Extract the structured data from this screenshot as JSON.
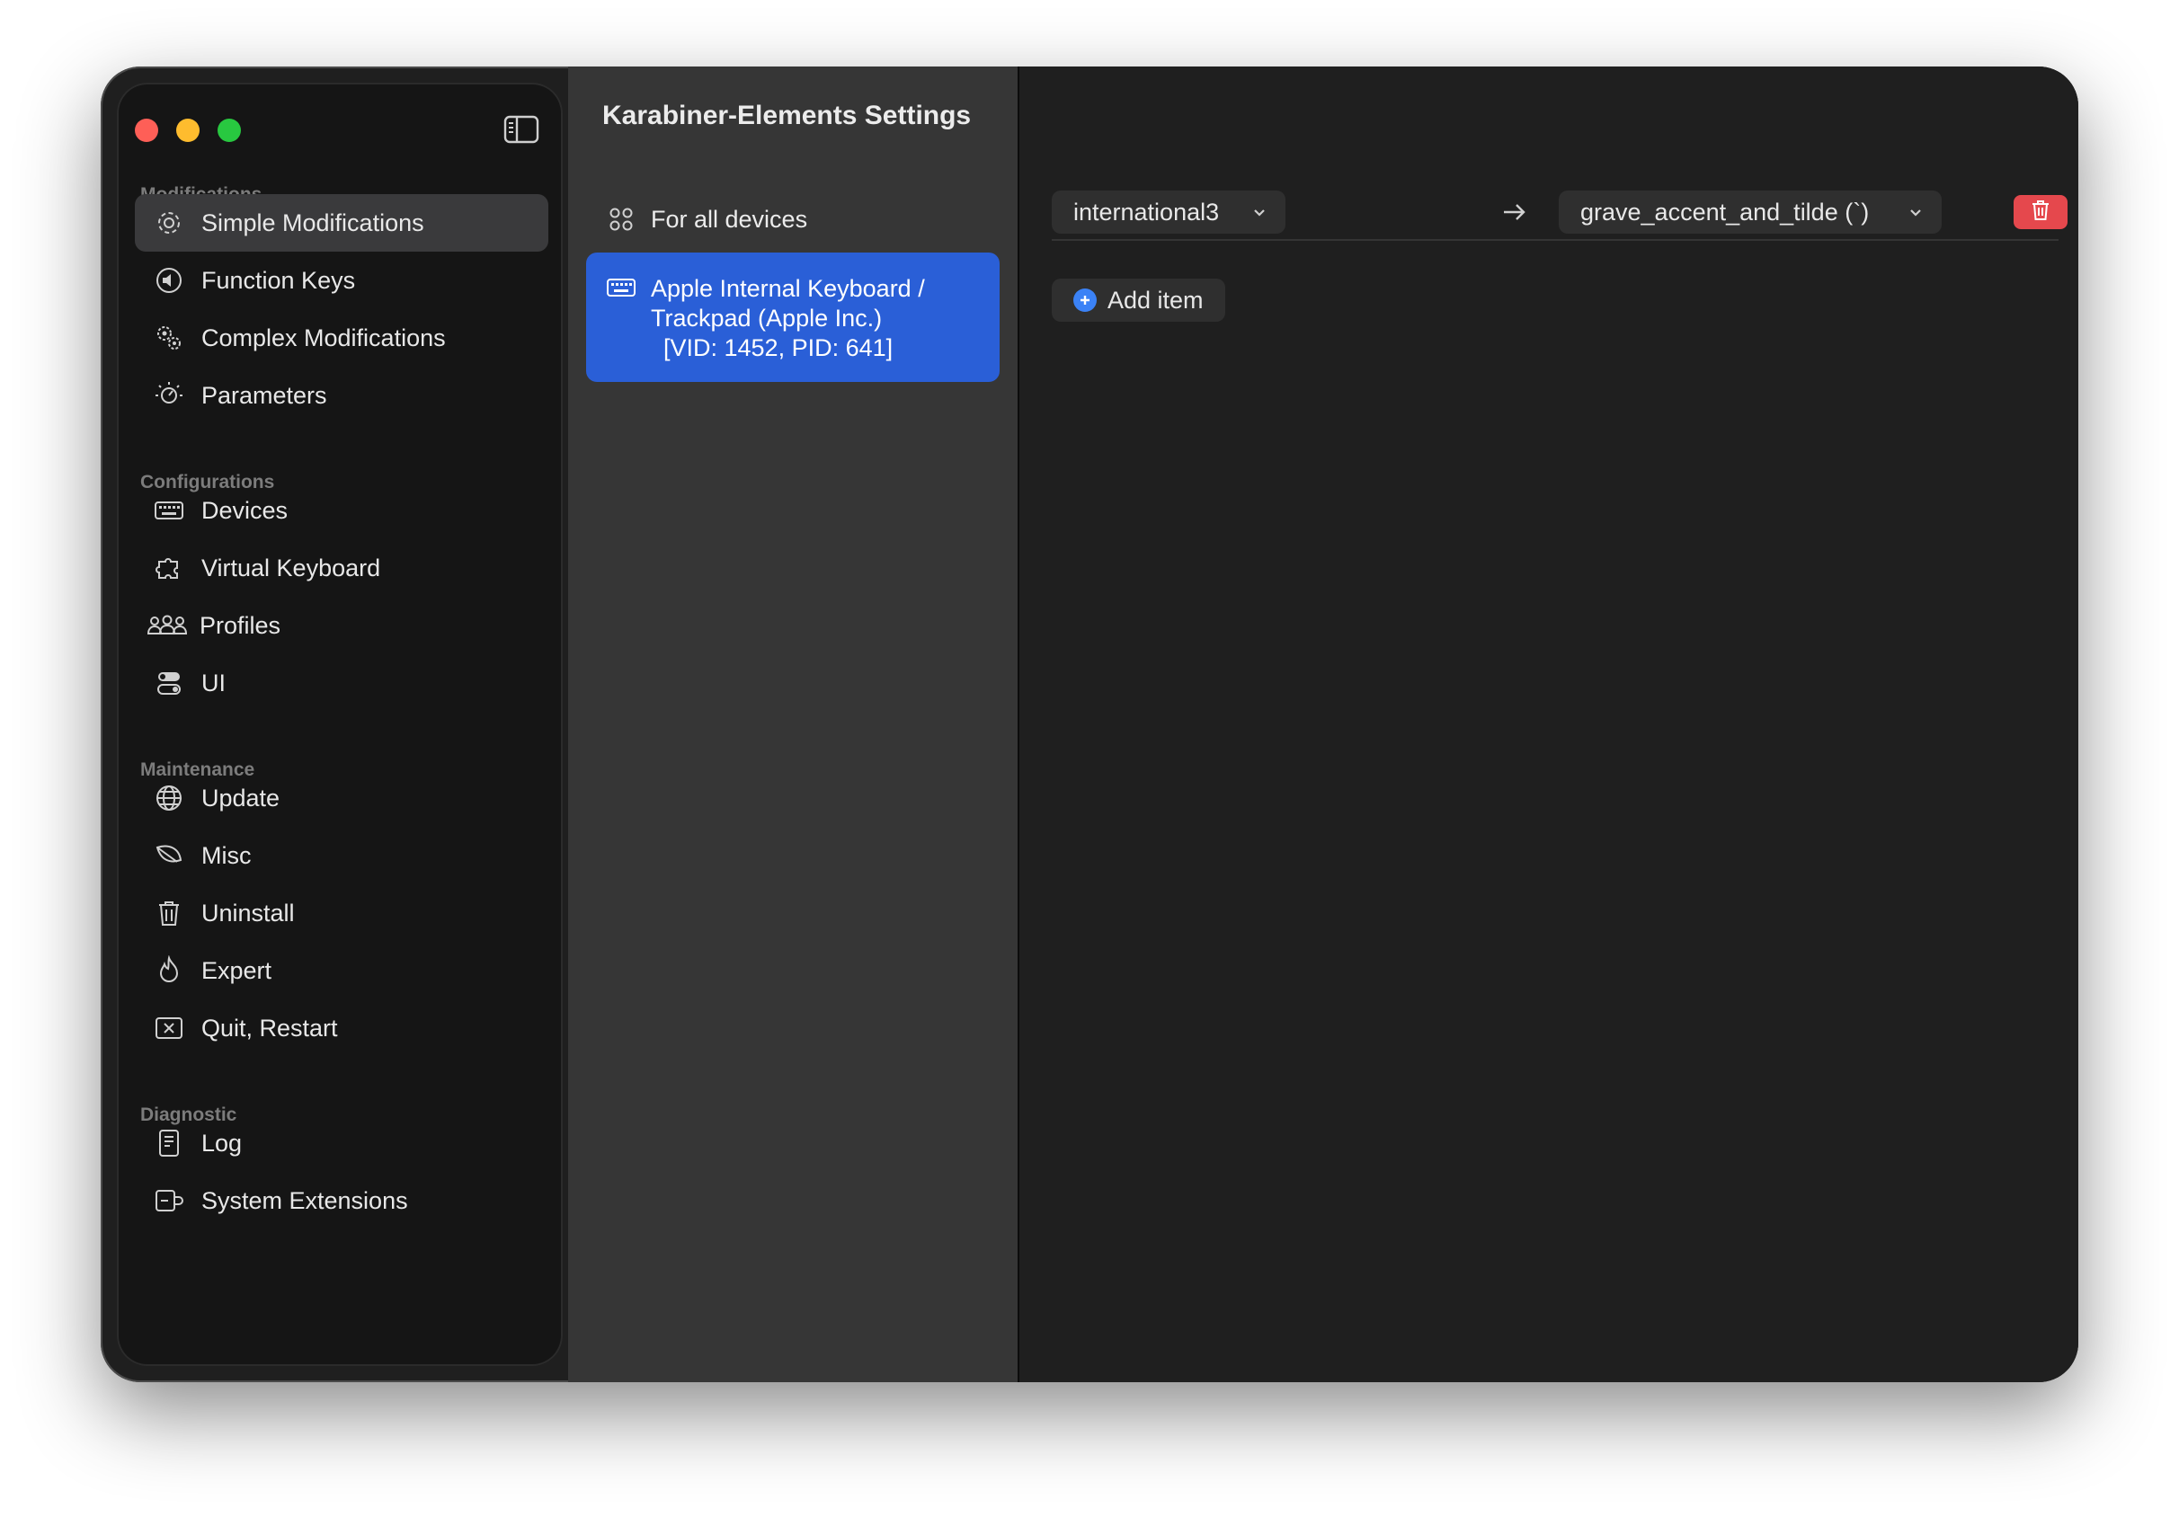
{
  "window": {
    "title": "Karabiner-Elements Settings"
  },
  "sidebar": {
    "sections": [
      {
        "heading": "Modifications",
        "items": [
          {
            "label": "Simple Modifications",
            "icon": "gear-icon",
            "selected": true
          },
          {
            "label": "Function Keys",
            "icon": "speaker-icon"
          },
          {
            "label": "Complex Modifications",
            "icon": "gears-icon"
          },
          {
            "label": "Parameters",
            "icon": "dial-icon"
          }
        ]
      },
      {
        "heading": "Configurations",
        "items": [
          {
            "label": "Devices",
            "icon": "keyboard-icon"
          },
          {
            "label": "Virtual Keyboard",
            "icon": "puzzle-icon"
          },
          {
            "label": "Profiles",
            "icon": "people-icon"
          },
          {
            "label": "UI",
            "icon": "switches-icon"
          }
        ]
      },
      {
        "heading": "Maintenance",
        "items": [
          {
            "label": "Update",
            "icon": "globe-icon"
          },
          {
            "label": "Misc",
            "icon": "leaf-icon"
          },
          {
            "label": "Uninstall",
            "icon": "trash-icon"
          },
          {
            "label": "Expert",
            "icon": "flame-icon"
          },
          {
            "label": "Quit, Restart",
            "icon": "xmark-square-icon"
          }
        ]
      },
      {
        "heading": "Diagnostic",
        "items": [
          {
            "label": "Log",
            "icon": "document-icon"
          },
          {
            "label": "System Extensions",
            "icon": "extension-icon"
          }
        ]
      }
    ]
  },
  "devices": {
    "items": [
      {
        "label": "For all devices",
        "icon": "grid-icon",
        "selected": false
      },
      {
        "line1": "Apple Internal Keyboard /",
        "line2": "Trackpad (Apple Inc.)",
        "line3": "[VID: 1452, PID: 641]",
        "icon": "keyboard-icon",
        "selected": true
      }
    ]
  },
  "mapping": {
    "from_value": "international3",
    "to_value": "grave_accent_and_tilde (`)",
    "add_item_label": "Add item",
    "accent_color": "#2a5fd7",
    "delete_color": "#e5484d"
  }
}
